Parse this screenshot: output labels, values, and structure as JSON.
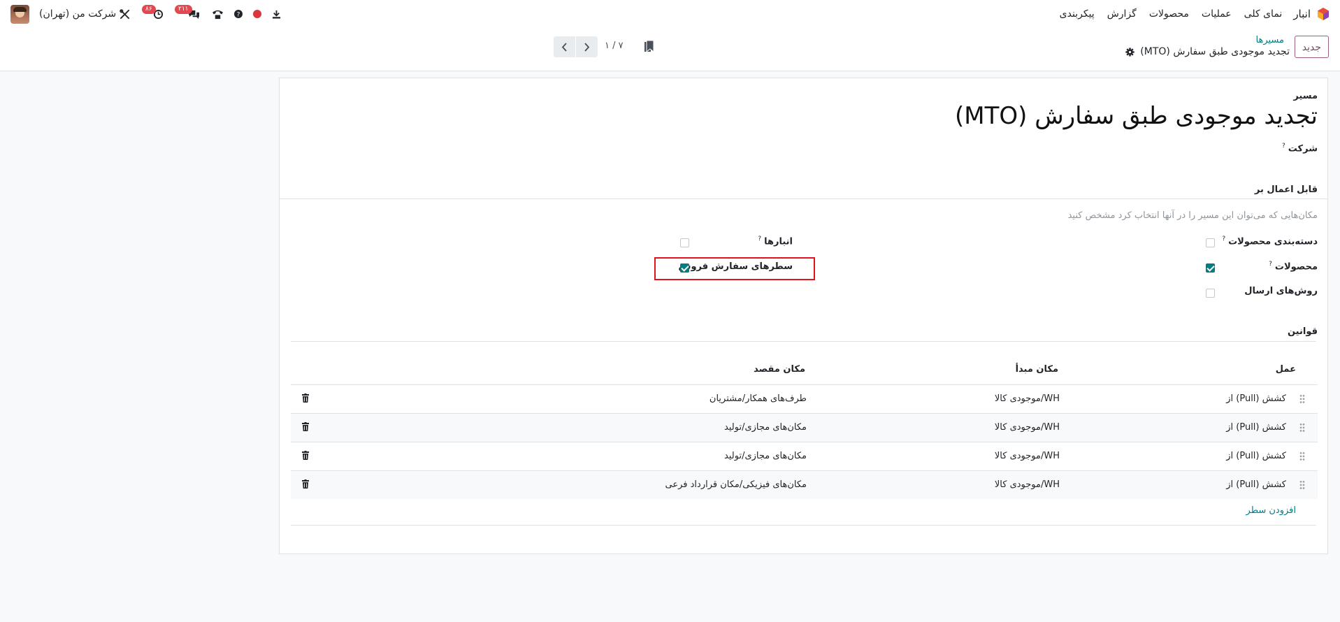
{
  "navbar": {
    "app_name": "انبار",
    "menu": [
      "نمای کلی",
      "عملیات",
      "محصولات",
      "گزارش",
      "پیکربندی"
    ],
    "company": "شرکت من (تهران)",
    "activity_badge": "۸۶",
    "messages_badge": "۲۱۱",
    "brand_color": "#714b67"
  },
  "control": {
    "new_button": "جدید",
    "breadcrumb_parent": "مسیرها",
    "breadcrumb_current": "تجدید موجودی طبق سفارش (MTO)",
    "pager_value": "۱ / ۷"
  },
  "form": {
    "route_label": "مسیر",
    "title": "تجدید موجودی طبق سفارش (MTO)",
    "company_label": "شرکت",
    "applicable_header": "قابل اعمال بر",
    "applicable_hint": "مکان‌هایی که می‌توان این مسیر را در آنها انتخاب کرد مشخص کنید",
    "fields": {
      "product_categories": {
        "label": "دسته‌بندی محصولات",
        "checked": false
      },
      "products": {
        "label": "محصولات",
        "checked": true
      },
      "shipping_methods": {
        "label": "روش‌های ارسال",
        "checked": false
      },
      "warehouses": {
        "label": "انبارها",
        "checked": false
      },
      "sale_order_lines": {
        "label": "سطرهای سفارش فروش",
        "checked": true
      }
    },
    "rules_header": "قوانین",
    "columns": {
      "action": "عمل",
      "source": "مکان مبدأ",
      "destination": "مکان مقصد"
    },
    "rows": [
      {
        "action": "کشش (Pull) از",
        "source": "WH/موجودی کالا",
        "destination": "طرف‌های همکار/مشتریان"
      },
      {
        "action": "کشش (Pull) از",
        "source": "WH/موجودی کالا",
        "destination": "مکان‌های مجازی/تولید"
      },
      {
        "action": "کشش (Pull) از",
        "source": "WH/موجودی کالا",
        "destination": "مکان‌های مجازی/تولید"
      },
      {
        "action": "کشش (Pull) از",
        "source": "WH/موجودی کالا",
        "destination": "مکان‌های فیزیکی/مکان قرارداد فرعی"
      }
    ],
    "add_line": "افزودن سطر",
    "accent_color": "#017e84"
  }
}
